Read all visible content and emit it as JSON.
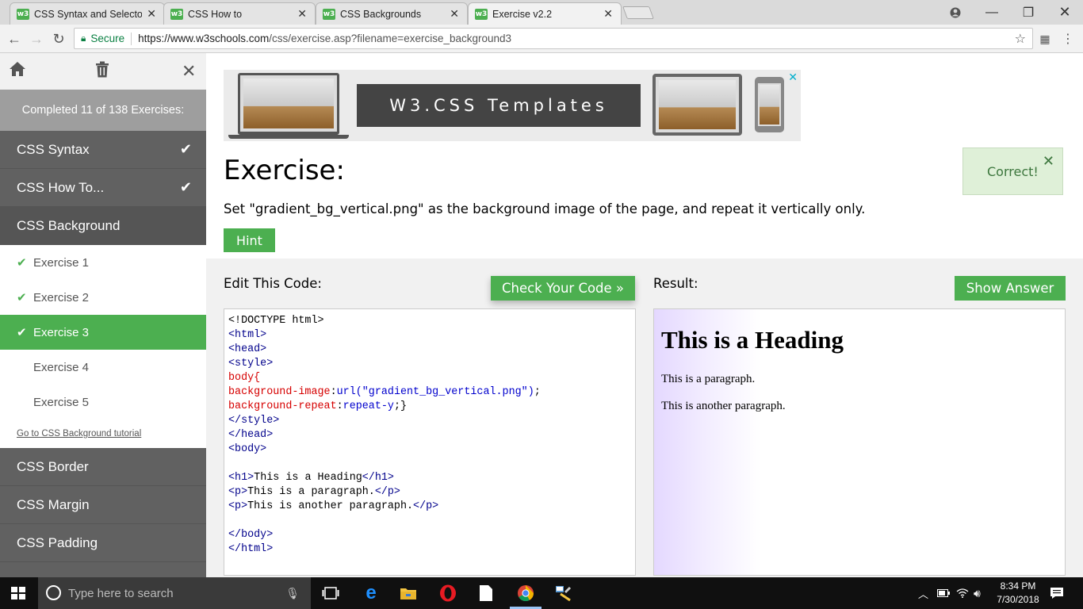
{
  "browser": {
    "tabs": [
      {
        "favicon": "w3",
        "title": "CSS Syntax and Selectors"
      },
      {
        "favicon": "w3",
        "title": "CSS How to"
      },
      {
        "favicon": "w3",
        "title": "CSS Backgrounds"
      },
      {
        "favicon": "w3",
        "title": "Exercise v2.2"
      }
    ],
    "secure_label": "Secure",
    "url_domain": "https://www.w3schools.com",
    "url_path": "/css/exercise.asp?filename=exercise_background3"
  },
  "sidebar": {
    "progress": "Completed 11 of 138 Exercises:",
    "categories_before": [
      "CSS Syntax",
      "CSS How To..."
    ],
    "open_category": "CSS Background",
    "exercises": [
      "Exercise 1",
      "Exercise 2",
      "Exercise 3",
      "Exercise 4",
      "Exercise 5"
    ],
    "tutorial_link": "Go to CSS Background tutorial",
    "categories_after": [
      "CSS Border",
      "CSS Margin",
      "CSS Padding"
    ]
  },
  "ad": {
    "text": "W3.CSS Templates"
  },
  "exercise": {
    "title": "Exercise:",
    "description": "Set \"gradient_bg_vertical.png\" as the background image of the page, and repeat it vertically only.",
    "hint_label": "Hint",
    "correct_label": "Correct!"
  },
  "editor": {
    "label": "Edit This Code:",
    "check_label": "Check Your Code »",
    "lines": {
      "l1": "<!DOCTYPE html>",
      "l2": "<html>",
      "l3": "<head>",
      "l4": "<style>",
      "l5": "body{",
      "l6_prop": "background-image",
      "l6_val": "url(\"gradient_bg_vertical.png\")",
      "l7_prop": "background-repeat",
      "l7_val": "repeat-y",
      "l8": "</style>",
      "l9": "</head>",
      "l10": "<body>",
      "l12_open": "<h1>",
      "l12_text": "This is a Heading",
      "l12_close": "</h1>",
      "l13_open": "<p>",
      "l13_text": "This is a paragraph.",
      "l13_close": "</p>",
      "l14_open": "<p>",
      "l14_text": "This is another paragraph.",
      "l14_close": "</p>",
      "l16": "</body>",
      "l17": "</html>"
    }
  },
  "result": {
    "label": "Result:",
    "show_answer_label": "Show Answer",
    "heading": "This is a Heading",
    "paragraphs": [
      "This is a paragraph.",
      "This is another paragraph."
    ]
  },
  "taskbar": {
    "search_placeholder": "Type here to search",
    "time": "8:34 PM",
    "date": "7/30/2018"
  },
  "colors": {
    "accent_green": "#4caf50",
    "sidebar_dark": "#616161",
    "correct_bg": "#dff0d8"
  }
}
